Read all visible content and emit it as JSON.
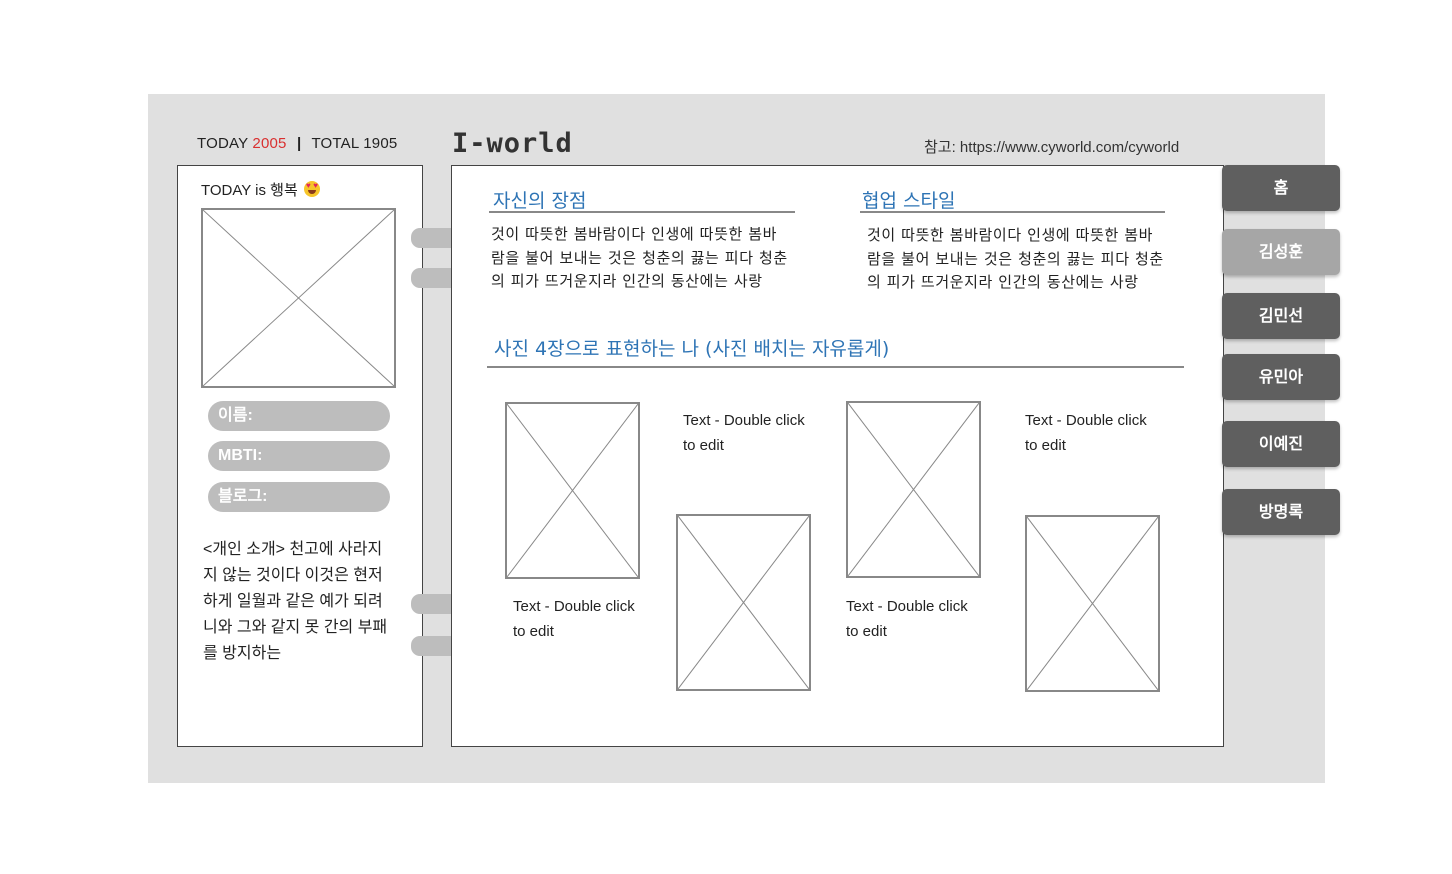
{
  "header": {
    "today_label": "TODAY",
    "today_count": "2005",
    "separator": "|",
    "total_label": "TOTAL",
    "total_count": "1905",
    "brand": "I-world",
    "reference": "참고: https://www.cyworld.com/cyworld"
  },
  "profile": {
    "mood_prefix": "TODAY is 행복",
    "mood_emoji": "smiling-face-with-heart-eyes",
    "fields": [
      {
        "label": "이름:"
      },
      {
        "label": "MBTI:"
      },
      {
        "label": "블로그:"
      }
    ],
    "intro": "<개인 소개> 천고에 사라지지 않는 것이다 이것은 현저하게 일월과 같은 예가 되려니와 그와 같지 못 간의 부패를 방지하는"
  },
  "main": {
    "strengths": {
      "title": "자신의 장점",
      "text": "것이 따뜻한 봄바람이다 인생에 따뜻한 봄바람을 불어 보내는 것은 청춘의 끓는 피다 청춘의 피가 뜨거운지라 인간의 동산에는 사랑"
    },
    "collab": {
      "title": "협업 스타일",
      "text": "것이 따뜻한 봄바람이다 인생에 따뜻한 봄바람을 불어 보내는 것은 청춘의 끓는 피다 청춘의 피가 뜨거운지라 인간의 동산에는 사랑"
    },
    "photos_title": "사진 4장으로 표현하는 나 (사진 배치는 자유롭게)",
    "captions": [
      "Text - Double click to edit",
      "Text - Double click to edit",
      "Text - Double click to edit",
      "Text - Double click to edit"
    ]
  },
  "nav": {
    "items": [
      {
        "label": "홈",
        "active": false
      },
      {
        "label": "김성훈",
        "active": true
      },
      {
        "label": "김민선",
        "active": false
      },
      {
        "label": "유민아",
        "active": false
      },
      {
        "label": "이예진",
        "active": false
      },
      {
        "label": "방명록",
        "active": false
      }
    ]
  },
  "colors": {
    "frame_bg": "#e0e0e0",
    "accent_blue": "#2e74b5",
    "today_count": "#d93030",
    "nav_bg": "#5f5f5f",
    "nav_active_bg": "#a6a6a6",
    "pill_bg": "#bdbdbd"
  }
}
